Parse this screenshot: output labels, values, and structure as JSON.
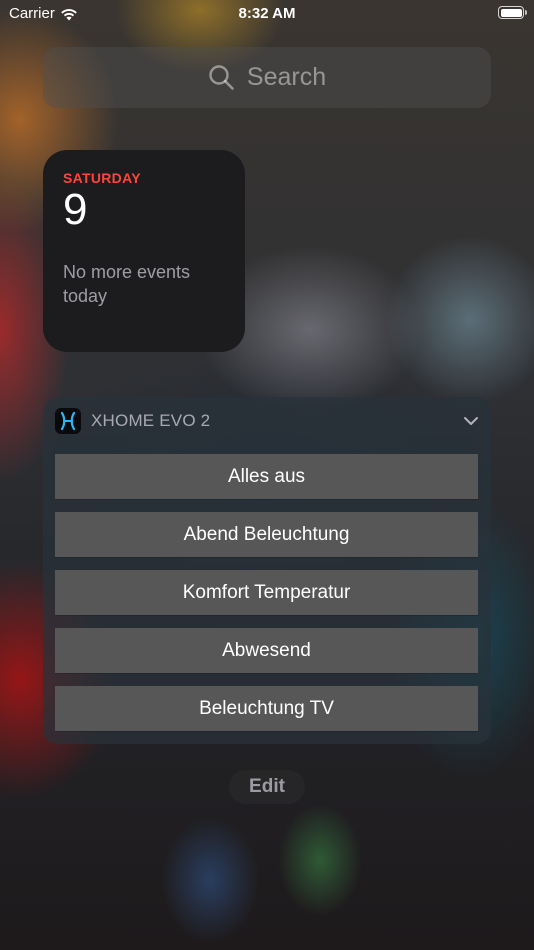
{
  "status_bar": {
    "carrier": "Carrier",
    "time": "8:32 AM"
  },
  "search": {
    "placeholder": "Search"
  },
  "calendar_widget": {
    "weekday": "SATURDAY",
    "date": "9",
    "note": "No more events today",
    "accent_color": "#ff453a"
  },
  "xhome_widget": {
    "app_name": "XHOME EVO 2",
    "icon": "xhome-logo-icon",
    "actions": [
      {
        "label": "Alles aus"
      },
      {
        "label": "Abend Beleuchtung"
      },
      {
        "label": "Komfort Temperatur"
      },
      {
        "label": "Abwesend"
      },
      {
        "label": "Beleuchtung TV"
      }
    ]
  },
  "edit_label": "Edit"
}
